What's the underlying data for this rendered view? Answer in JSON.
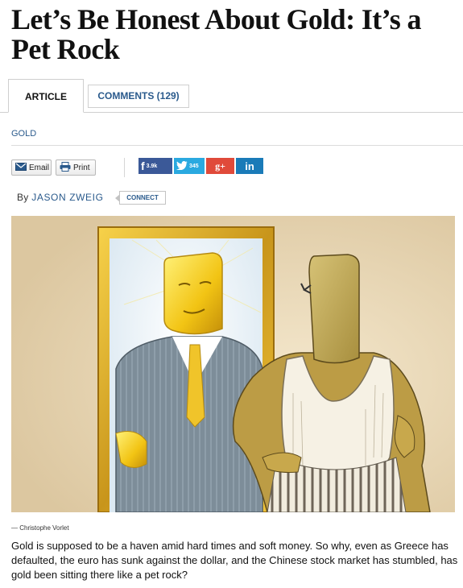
{
  "article": {
    "headline": "Let’s Be Honest About Gold: It’s a Pet Rock",
    "section": "GOLD",
    "byline_prefix": "By",
    "author": "JASON ZWEIG",
    "connect_label": "CONNECT",
    "image_credit": "— Christophe Vorlet",
    "lead_paragraph": "Gold is supposed to be a haven amid hard times and soft money. So why, even as Greece has defaulted, the euro has sunk against the dollar, and the Chinese stock market has stumbled, has gold been sitting there like a pet rock?"
  },
  "tabs": [
    {
      "label": "ARTICLE",
      "active": true
    },
    {
      "label": "COMMENTS (129)",
      "active": false
    }
  ],
  "tools": {
    "email_label": "Email",
    "print_label": "Print"
  },
  "share": {
    "facebook_count": "3.9k",
    "twitter_count": "345",
    "googleplus_label": "g+",
    "linkedin_label": "in"
  },
  "icons": [
    "envelope-icon",
    "printer-icon",
    "facebook-icon",
    "twitter-bird-icon",
    "google-plus-icon",
    "linkedin-icon"
  ],
  "colors": {
    "link_blue": "#2a5a8c",
    "facebook": "#3b5998",
    "twitter": "#2aa9e0",
    "googleplus": "#e04a3a",
    "linkedin": "#1a7bb8"
  }
}
